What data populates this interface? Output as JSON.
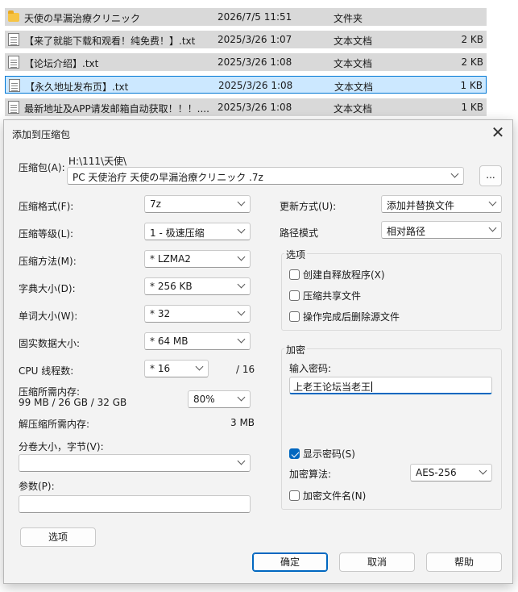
{
  "files": [
    {
      "name": "天使の早漏治療クリニック",
      "date": "2026/7/5 11:51",
      "type": "文件夹",
      "size": "",
      "icon": "folder-icon"
    },
    {
      "name": "【来了就能下载和观看！纯免费！】.txt",
      "date": "2025/3/26 1:07",
      "type": "文本文档",
      "size": "2 KB",
      "icon": "text-file-icon"
    },
    {
      "name": "【论坛介绍】.txt",
      "date": "2025/3/26 1:08",
      "type": "文本文档",
      "size": "2 KB",
      "icon": "text-file-icon"
    },
    {
      "name": "【永久地址发布页】.txt",
      "date": "2025/3/26 1:08",
      "type": "文本文档",
      "size": "1 KB",
      "icon": "text-file-icon",
      "selected": true
    },
    {
      "name": "最新地址及APP请发邮箱自动获取！！！....",
      "date": "2025/3/26 1:08",
      "type": "文本文档",
      "size": "1 KB",
      "icon": "text-file-icon"
    }
  ],
  "dialog": {
    "title": "添加到压缩包",
    "close_glyph": "✕",
    "archive": {
      "label": "压缩包(A):",
      "path": "H:\\111\\天使\\",
      "filename": "PC 天使治疗 天使の早漏治療クリニック .7z",
      "browse_label": "..."
    },
    "left": {
      "format_label": "压缩格式(F):",
      "format_value": "7z",
      "level_label": "压缩等级(L):",
      "level_value": "1 - 极速压缩",
      "method_label": "压缩方法(M):",
      "method_value": "*  LZMA2",
      "dict_label": "字典大小(D):",
      "dict_value": "*  256 KB",
      "word_label": "单词大小(W):",
      "word_value": "*  32",
      "solid_label": "固实数据大小:",
      "solid_value": "*  64 MB",
      "threads_label": "CPU 线程数:",
      "threads_value": "*  16",
      "threads_max": "/ 16",
      "mem_comp_label": "压缩所需内存:",
      "mem_comp_detail": "99 MB / 26 GB / 32 GB",
      "mem_comp_value": "80%",
      "mem_decomp_label": "解压缩所需内存:",
      "mem_decomp_value": "3 MB",
      "split_label": "分卷大小，字节(V):",
      "split_value": "",
      "params_label": "参数(P):",
      "params_value": "",
      "options_button": "选项"
    },
    "right": {
      "update_label": "更新方式(U):",
      "update_value": "添加并替换文件",
      "pathmode_label": "路径模式",
      "pathmode_value": "相对路径",
      "options_group": "选项",
      "opt_sfx": "创建自释放程序(X)",
      "opt_shared": "压缩共享文件",
      "opt_delete": "操作完成后删除源文件",
      "encryption_group": "加密",
      "password_label": "输入密码:",
      "password_value": "上老王论坛当老王",
      "show_password": "显示密码(S)",
      "enc_method_label": "加密算法:",
      "enc_method_value": "AES-256",
      "encrypt_names": "加密文件名(N)"
    },
    "buttons": {
      "ok": "确定",
      "cancel": "取消",
      "help": "帮助"
    }
  },
  "colors": {
    "accent": "#0067c0",
    "selection": "#cce8ff",
    "row_bg": "#d9d9d9"
  }
}
